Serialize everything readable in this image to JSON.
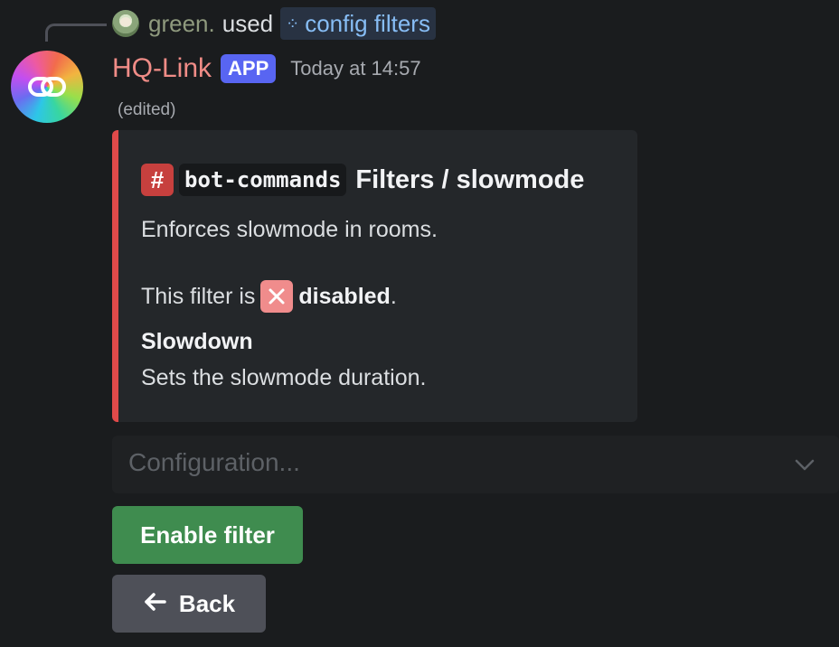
{
  "reply": {
    "user": "green.",
    "verb": "used",
    "command": "config filters"
  },
  "message": {
    "bot_name": "HQ-Link",
    "badge": "APP",
    "timestamp": "Today at 14:57",
    "edited": "(edited)"
  },
  "embed": {
    "accent_color": "#e04a4a",
    "hash_icon": "#",
    "channel": "bot-commands",
    "title": "Filters / slowmode",
    "description": "Enforces slowmode in rooms.",
    "status_prefix": "This filter is",
    "status_value": "disabled",
    "status_suffix": ".",
    "field_name": "Slowdown",
    "field_value": "Sets the slowmode duration."
  },
  "select": {
    "placeholder": "Configuration..."
  },
  "buttons": {
    "enable_label": "Enable filter",
    "back_label": "Back",
    "enable_color": "#3f8c4f",
    "back_color": "#4e5058"
  },
  "icons": {
    "avatar": "chain-link-icon",
    "command": "slash-command-icon",
    "status": "x-mark-icon",
    "select": "chevron-down-icon",
    "back": "arrow-left-icon"
  }
}
